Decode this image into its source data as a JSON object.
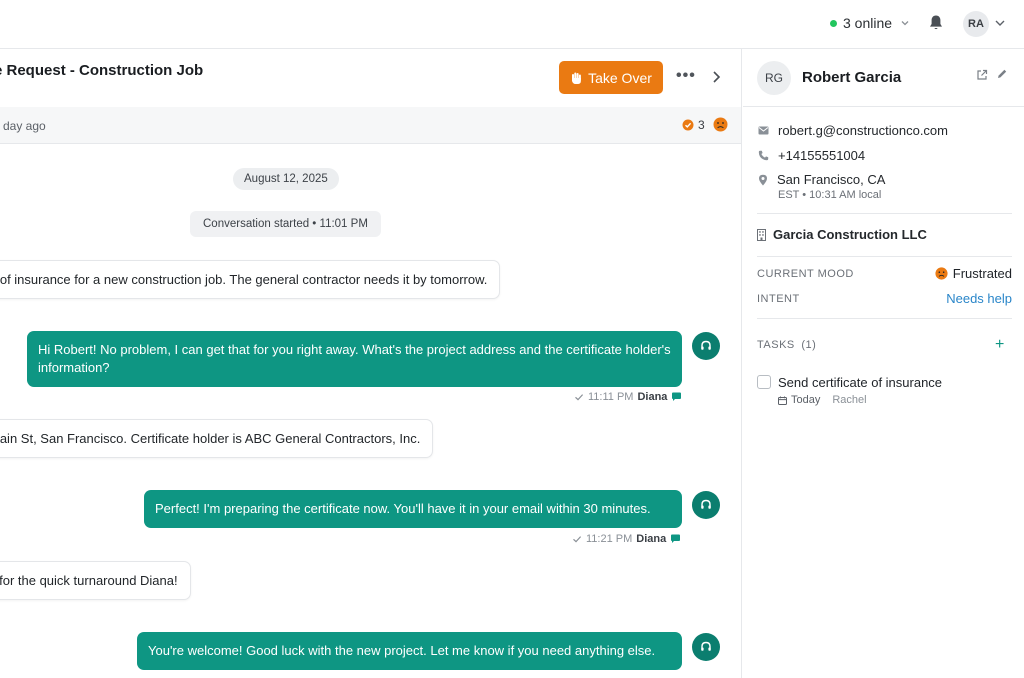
{
  "topbar": {
    "online_label": "3 online",
    "user_initials": "RA"
  },
  "conversation": {
    "title": "e Request - Construction Job",
    "take_over_label": "Take Over",
    "updated_label": "day ago",
    "alert_count": "3",
    "date_chip": "August 12, 2025",
    "started_chip": "Conversation started • 11:01 PM",
    "messages": [
      {
        "direction": "in",
        "text": "e of insurance for a new construction job. The general contractor needs it by tomorrow."
      },
      {
        "direction": "out",
        "text": "Hi Robert! No problem, I can get that for you right away. What's the project address and the certificate holder's information?",
        "time": "11:11 PM",
        "agent": "Diana"
      },
      {
        "direction": "in",
        "text": "Main St, San Francisco. Certificate holder is ABC General Contractors, Inc."
      },
      {
        "direction": "out",
        "text": "Perfect! I'm preparing the certificate now. You'll have it in your email within 30 minutes.",
        "time": "11:21 PM",
        "agent": "Diana"
      },
      {
        "direction": "in",
        "text": "s for the quick turnaround Diana!"
      },
      {
        "direction": "out",
        "text": "You're welcome! Good luck with the new project. Let me know if you need anything else."
      }
    ]
  },
  "customer": {
    "initials": "RG",
    "name": "Robert Garcia",
    "email": "robert.g@constructionco.com",
    "phone": "+14155551004",
    "location": "San Francisco, CA",
    "local_time": "EST • 10:31 AM local",
    "company": "Garcia Construction LLC",
    "mood_label": "CURRENT MOOD",
    "mood_value": "Frustrated",
    "intent_label": "INTENT",
    "intent_value": "Needs help",
    "tasks_label": "TASKS",
    "tasks_count": "(1)",
    "tasks": [
      {
        "label": "Send certificate of insurance",
        "due": "Today",
        "assignee": "Rachel"
      }
    ]
  },
  "colors": {
    "accent_orange": "#ea7a12",
    "agent_teal": "#0e9683",
    "online_green": "#22c55e",
    "intent_blue": "#2a86c9"
  },
  "icons": [
    "bell-icon",
    "chevron-down-icon",
    "hand-icon",
    "more-icon",
    "chevron-right-icon",
    "frown-icon",
    "headset-icon",
    "check-icon",
    "chat-icon",
    "external-link-icon",
    "edit-icon",
    "mail-icon",
    "phone-icon",
    "location-icon",
    "building-icon",
    "plus-icon",
    "calendar-icon"
  ]
}
